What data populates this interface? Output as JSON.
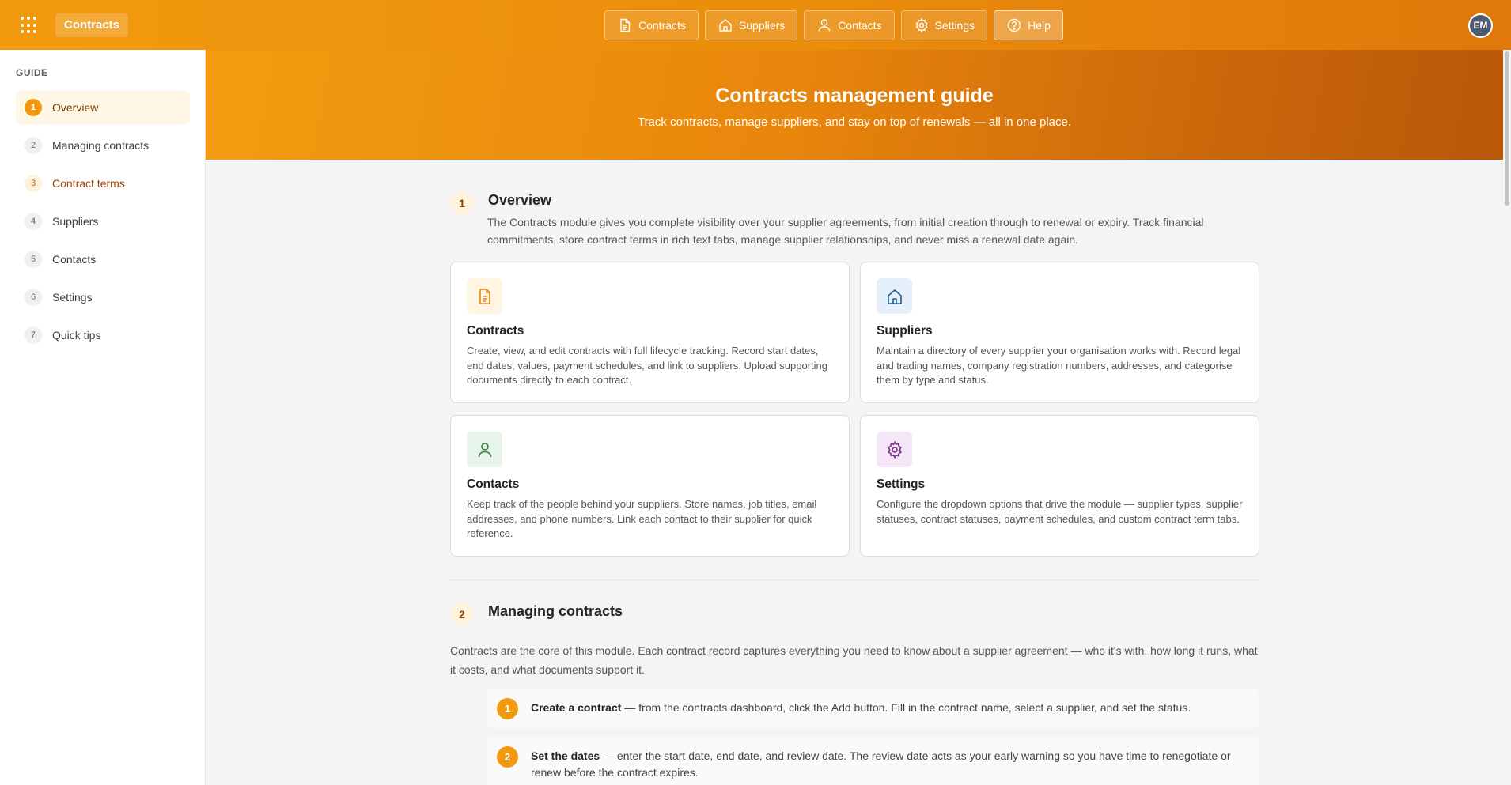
{
  "app": {
    "title": "Contracts"
  },
  "nav": [
    {
      "label": "Contracts",
      "icon": "document-icon"
    },
    {
      "label": "Suppliers",
      "icon": "building-icon"
    },
    {
      "label": "Contacts",
      "icon": "person-icon"
    },
    {
      "label": "Settings",
      "icon": "gear-icon"
    },
    {
      "label": "Help",
      "icon": "question-circle-icon",
      "active": true
    }
  ],
  "user": {
    "initials": "EM"
  },
  "sidebar": {
    "heading": "GUIDE",
    "items": [
      {
        "num": "1",
        "label": "Overview",
        "state": "active"
      },
      {
        "num": "2",
        "label": "Managing contracts",
        "state": "default"
      },
      {
        "num": "3",
        "label": "Contract terms",
        "state": "accent"
      },
      {
        "num": "4",
        "label": "Suppliers",
        "state": "default"
      },
      {
        "num": "5",
        "label": "Contacts",
        "state": "default"
      },
      {
        "num": "6",
        "label": "Settings",
        "state": "default"
      },
      {
        "num": "7",
        "label": "Quick tips",
        "state": "default"
      }
    ]
  },
  "hero": {
    "title": "Contracts management guide",
    "subtitle": "Track contracts, manage suppliers, and stay on top of renewals — all in one place."
  },
  "overview": {
    "num": "1",
    "title": "Overview",
    "description": "The Contracts module gives you complete visibility over your supplier agreements, from initial creation through to renewal or expiry. Track financial commitments, store contract terms in rich text tabs, manage supplier relationships, and never miss a renewal date again.",
    "cards": [
      {
        "title": "Contracts",
        "icon": "document-icon",
        "icon_color": "#e8890c",
        "icon_bg": "#fff6e3",
        "text": "Create, view, and edit contracts with full lifecycle tracking. Record start dates, end dates, values, payment schedules, and link to suppliers. Upload supporting documents directly to each contract."
      },
      {
        "title": "Suppliers",
        "icon": "building-icon",
        "icon_color": "#1f5a96",
        "icon_bg": "#e5f0fb",
        "text": "Maintain a directory of every supplier your organisation works with. Record legal and trading names, company registration numbers, addresses, and categorise them by type and status."
      },
      {
        "title": "Contacts",
        "icon": "person-icon",
        "icon_color": "#2f7d3e",
        "icon_bg": "#e6f4e9",
        "text": "Keep track of the people behind your suppliers. Store names, job titles, email addresses, and phone numbers. Link each contact to their supplier for quick reference."
      },
      {
        "title": "Settings",
        "icon": "gear-icon",
        "icon_color": "#7a2a8c",
        "icon_bg": "#f4e6f7",
        "text": "Configure the dropdown options that drive the module — supplier types, supplier statuses, contract statuses, payment schedules, and custom contract term tabs."
      }
    ]
  },
  "managing": {
    "num": "2",
    "title": "Managing contracts",
    "description": "Contracts are the core of this module. Each contract record captures everything you need to know about a supplier agreement — who it's with, how long it runs, what it costs, and what documents support it.",
    "steps": [
      {
        "num": "1",
        "bold": "Create a contract",
        "text": " — from the contracts dashboard, click the Add button. Fill in the contract name, select a supplier, and set the status."
      },
      {
        "num": "2",
        "bold": "Set the dates",
        "text": " — enter the start date, end date, and review date. The review date acts as your early warning so you have time to renegotiate or renew before the contract expires."
      }
    ]
  }
}
